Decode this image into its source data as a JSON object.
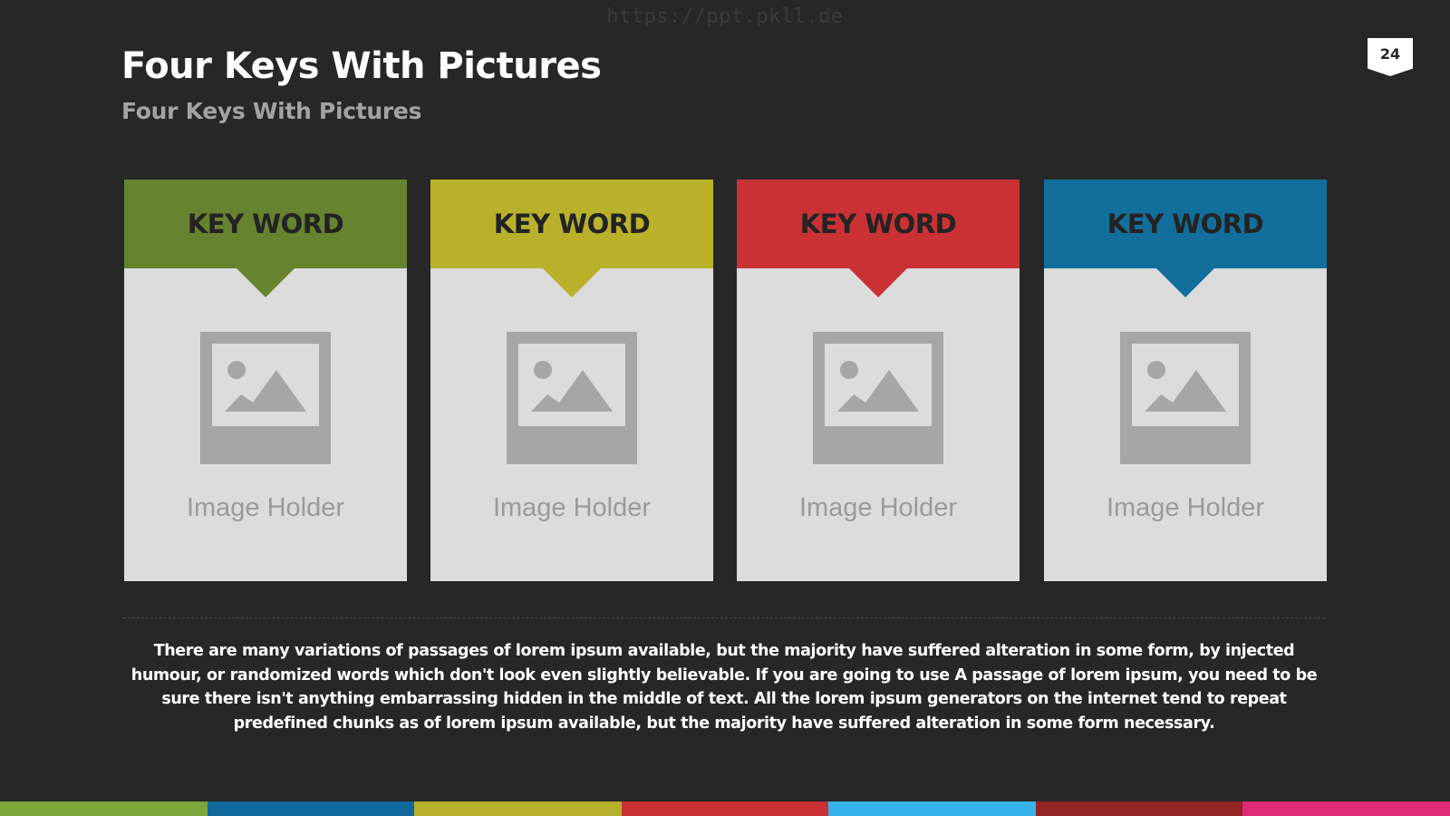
{
  "watermark": "https://ppt.pkll.de",
  "slide": {
    "title": "Four Keys With Pictures",
    "subtitle": "Four Keys With Pictures",
    "page_number": "24"
  },
  "cards": [
    {
      "title": "KEY WORD",
      "color": "#66832f",
      "image_icon": "image-placeholder-icon",
      "caption": "Image Holder"
    },
    {
      "title": "KEY WORD",
      "color": "#b9b12a",
      "image_icon": "image-placeholder-icon",
      "caption": "Image Holder"
    },
    {
      "title": "KEY WORD",
      "color": "#c93135",
      "image_icon": "image-placeholder-icon",
      "caption": "Image Holder"
    },
    {
      "title": "KEY WORD",
      "color": "#126f9c",
      "image_icon": "image-placeholder-icon",
      "caption": "Image Holder"
    }
  ],
  "body_text": "There are many variations of passages of lorem ipsum available, but the majority have suffered alteration in some form, by injected humour, or randomized words which don't look even slightly believable. If you are going to use A passage of lorem ipsum, you need to be sure there isn't anything embarrassing hidden in the middle of text. All the lorem ipsum generators on the internet tend to repeat predefined chunks as of lorem ipsum available, but the majority have suffered alteration in some form  necessary.",
  "colors": {
    "background": "#272728",
    "card_body": "#dcdcdc",
    "image_placeholder": "#a6a6a6",
    "bottom_bar": [
      "#7ba63a",
      "#11699b",
      "#b7b02a",
      "#c93135",
      "#35b2e8",
      "#942326",
      "#dd2b78"
    ]
  }
}
